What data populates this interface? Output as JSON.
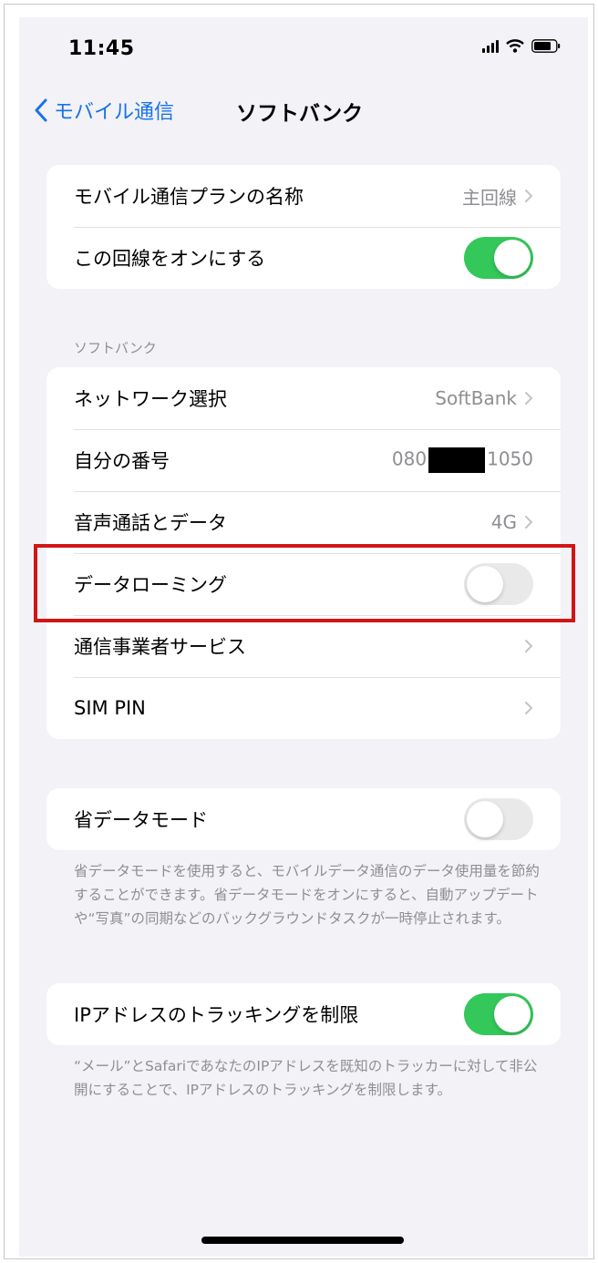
{
  "status_bar": {
    "time": "11:45"
  },
  "nav": {
    "back_label": "モバイル通信",
    "title": "ソフトバンク"
  },
  "group1": {
    "plan_label": "モバイル通信プランの名称",
    "plan_value": "主回線",
    "line_on_label": "この回線をオンにする",
    "line_on_state": true
  },
  "section": {
    "header": "ソフトバンク"
  },
  "group2": {
    "network_label": "ネットワーク選択",
    "network_value": "SoftBank",
    "number_label": "自分の番号",
    "number_prefix": "080",
    "number_suffix": "1050",
    "voice_label": "音声通話とデータ",
    "voice_value": "4G",
    "roaming_label": "データローミング",
    "roaming_state": false,
    "carrier_label": "通信事業者サービス",
    "simpin_label": "SIM PIN"
  },
  "group3": {
    "lowdata_label": "省データモード",
    "lowdata_state": false,
    "lowdata_footer": "省データモードを使用すると、モバイルデータ通信のデータ使用量を節約することができます。省データモードをオンにすると、自動アップデートや“写真”の同期などのバックグラウンドタスクが一時停止されます。"
  },
  "group4": {
    "ip_label": "IPアドレスのトラッキングを制限",
    "ip_state": true,
    "ip_footer": "“メール”とSafariであなたのIPアドレスを既知のトラッカーに対して非公開にすることで、IPアドレスのトラッキングを制限します。"
  },
  "colors": {
    "accent": "#1a73e8",
    "toggle_on": "#34c759",
    "highlight": "#d11515"
  }
}
